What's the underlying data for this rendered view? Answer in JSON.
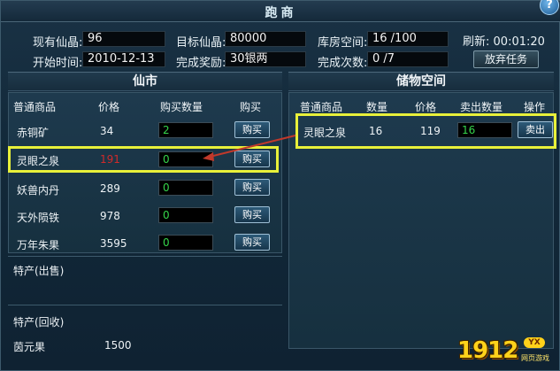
{
  "window": {
    "title": "跑商"
  },
  "info": {
    "current_label": "现有仙晶:",
    "current_value": "96",
    "target_label": "目标仙晶:",
    "target_value": "80000",
    "storage_label": "库房空间:",
    "storage_value": "16 /100",
    "refresh_label": "刷新:",
    "refresh_value": "00:01:20",
    "start_label": "开始时间:",
    "start_value": "2010-12-13",
    "reward_label": "完成奖励:",
    "reward_value": "30银两",
    "count_label": "完成次数:",
    "count_value": "0   /7",
    "abandon_label": "放弃任务"
  },
  "market": {
    "title": "仙市",
    "columns": [
      "普通商品",
      "价格",
      "购买数量",
      "购买"
    ],
    "buy_label": "购买",
    "rows": [
      {
        "name": "赤铜矿",
        "price": "34",
        "qty": "2"
      },
      {
        "name": "灵眼之泉",
        "price": "191",
        "qty": "0"
      },
      {
        "name": "妖兽内丹",
        "price": "289",
        "qty": "0"
      },
      {
        "name": "天外陨铁",
        "price": "978",
        "qty": "0"
      },
      {
        "name": "万年朱果",
        "price": "3595",
        "qty": "0"
      }
    ],
    "special_sell_label": "特产(出售)",
    "special_buyback_label": "特产(回收)",
    "special_buyback_items": [
      {
        "name": "茵元果",
        "price": "1500"
      }
    ]
  },
  "storage": {
    "title": "储物空间",
    "columns": [
      "普通商品",
      "数量",
      "价格",
      "卖出数量",
      "操作"
    ],
    "sell_label": "卖出",
    "rows": [
      {
        "name": "灵眼之泉",
        "qty": "16",
        "price": "119",
        "sell_qty": "16"
      }
    ]
  },
  "watermark": {
    "brand": "1912",
    "badge": "YX",
    "tagline": "网页游戏"
  },
  "colors": {
    "highlight": "#e8f03a",
    "qty_green": "#35d54a",
    "price_red": "#d02a2a",
    "arrow": "#c0392b"
  }
}
